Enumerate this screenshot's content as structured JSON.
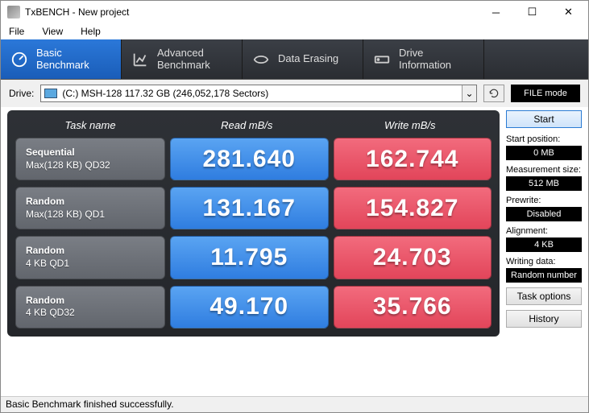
{
  "window": {
    "title": "TxBENCH - New project"
  },
  "menu": {
    "file": "File",
    "view": "View",
    "help": "Help"
  },
  "tabs": {
    "basic": "Basic\nBenchmark",
    "advanced": "Advanced\nBenchmark",
    "erase": "Data Erasing",
    "drive": "Drive\nInformation"
  },
  "drive": {
    "label": "Drive:",
    "value": "(C:) MSH-128  117.32 GB (246,052,178 Sectors)"
  },
  "filemode": "FILE mode",
  "headers": {
    "task": "Task name",
    "read": "Read mB/s",
    "write": "Write mB/s"
  },
  "rows": [
    {
      "name": "Sequential",
      "sub": "Max(128 KB) QD32",
      "read": "281.640",
      "write": "162.744"
    },
    {
      "name": "Random",
      "sub": "Max(128 KB) QD1",
      "read": "131.167",
      "write": "154.827"
    },
    {
      "name": "Random",
      "sub": "4 KB QD1",
      "read": "11.795",
      "write": "24.703"
    },
    {
      "name": "Random",
      "sub": "4 KB QD32",
      "read": "49.170",
      "write": "35.766"
    }
  ],
  "side": {
    "start": "Start",
    "startpos_l": "Start position:",
    "startpos_v": "0 MB",
    "meas_l": "Measurement size:",
    "meas_v": "512 MB",
    "prew_l": "Prewrite:",
    "prew_v": "Disabled",
    "align_l": "Alignment:",
    "align_v": "4 KB",
    "wdata_l": "Writing data:",
    "wdata_v": "Random number",
    "taskopt": "Task options",
    "history": "History"
  },
  "status": "Basic Benchmark finished successfully."
}
